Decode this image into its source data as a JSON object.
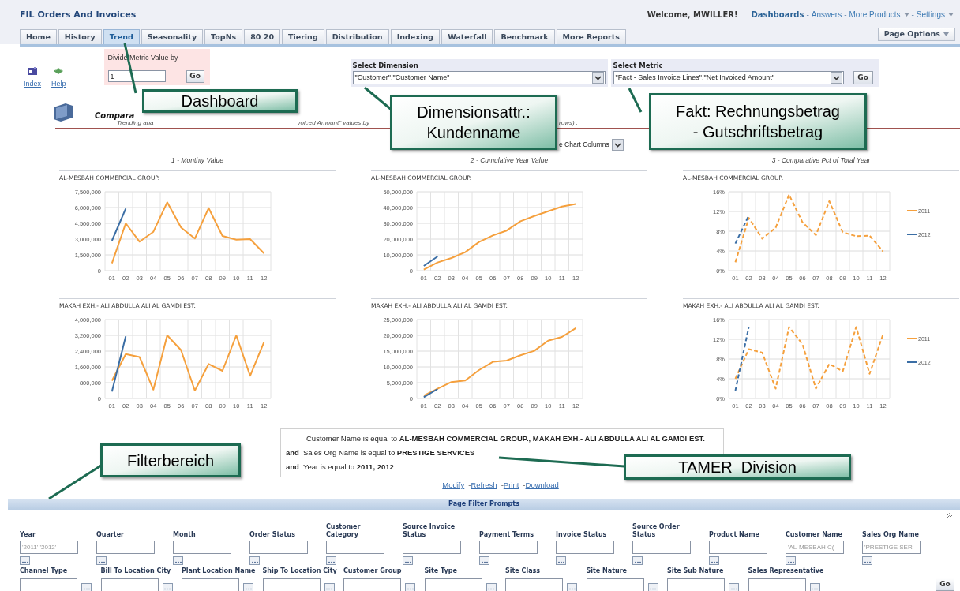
{
  "header": {
    "title": "FIL Orders And Invoices",
    "welcome": "Welcome, MWILLER!",
    "nav": [
      {
        "label": "Dashboards",
        "selected": true,
        "dropdown": false
      },
      {
        "prefix": "-",
        "label": "Answers",
        "selected": false,
        "dropdown": false
      },
      {
        "prefix": "-",
        "label": "More Products",
        "selected": false,
        "dropdown": true
      },
      {
        "prefix": "-",
        "label": "Settings",
        "selected": false,
        "dropdown": true
      }
    ]
  },
  "tabs": [
    {
      "label": "Home",
      "selected": false
    },
    {
      "label": "History",
      "selected": false
    },
    {
      "label": "Trend",
      "selected": true
    },
    {
      "label": "Seasonality",
      "selected": false
    },
    {
      "label": "TopNs",
      "selected": false
    },
    {
      "label": "80 20",
      "selected": false
    },
    {
      "label": "Tiering",
      "selected": false
    },
    {
      "label": "Distribution",
      "selected": false
    },
    {
      "label": "Indexing",
      "selected": false
    },
    {
      "label": "Waterfall",
      "selected": false
    },
    {
      "label": "Benchmark",
      "selected": false
    },
    {
      "label": "More Reports",
      "selected": false
    }
  ],
  "page_options": "Page Options",
  "toolbar": {
    "links": [
      {
        "kind": "index",
        "label": "Index"
      },
      {
        "kind": "help",
        "label": "Help"
      }
    ],
    "divide": {
      "label": "Divide Metric Value by",
      "value": "1",
      "button": "Go"
    },
    "dimension": {
      "label": "Select Dimension",
      "value": "\"Customer\".\"Customer Name\""
    },
    "metric": {
      "label": "Select Metric",
      "value": "\"Fact - Sales Invoice Lines\".\"Net Invoiced Amount\"",
      "button": "Go"
    }
  },
  "section": {
    "title": "Compara",
    "description": [
      "Trending ana",
      "voiced Amount\" values by",
      "rows) :"
    ],
    "column_chooser": "e Chart Columns"
  },
  "charts": {
    "column_titles": [
      "1 - Monthly Value",
      "2 - Cumulative Year Value",
      "3 - Comparative Pct of Total Year"
    ],
    "rows": [
      [
        {
          "chart_data": {
            "type": "line",
            "grid": true,
            "title": "AL-MESBAH COMMERCIAL GROUP.",
            "categories": [
              "01",
              "02",
              "03",
              "04",
              "05",
              "06",
              "07",
              "08",
              "09",
              "10",
              "11",
              "12"
            ],
            "ylim": [
              0,
              7500000
            ],
            "yticks": [
              {
                "value": 0,
                "label": "0"
              },
              {
                "value": 1500000,
                "label": "1,500,000"
              },
              {
                "value": 3000000,
                "label": "3,000,000"
              },
              {
                "value": 4500000,
                "label": "4,500,000"
              },
              {
                "value": 6000000,
                "label": "6,000,000"
              },
              {
                "value": 7500000,
                "label": "7,500,000"
              }
            ],
            "series": [
              {
                "color": "#f5a03d",
                "values": [
                  700000,
                  4500000,
                  2750000,
                  3700000,
                  6500000,
                  4100000,
                  3050000,
                  5950000,
                  3300000,
                  2950000,
                  3000000,
                  1650000
                ]
              },
              {
                "color": "#3b6ea5",
                "values": [
                  2850000,
                  5900000,
                  null,
                  null,
                  null,
                  null,
                  null,
                  null,
                  null,
                  null,
                  null,
                  null
                ]
              }
            ]
          }
        },
        {
          "chart_data": {
            "type": "line",
            "grid": true,
            "title": "AL-MESBAH COMMERCIAL GROUP.",
            "categories": [
              "01",
              "02",
              "03",
              "04",
              "05",
              "06",
              "07",
              "08",
              "09",
              "10",
              "11",
              "12"
            ],
            "ylim": [
              0,
              50000000
            ],
            "yticks": [
              {
                "value": 0,
                "label": "0"
              },
              {
                "value": 10000000,
                "label": "10,000,000"
              },
              {
                "value": 20000000,
                "label": "20,000,000"
              },
              {
                "value": 30000000,
                "label": "30,000,000"
              },
              {
                "value": 40000000,
                "label": "40,000,000"
              },
              {
                "value": 50000000,
                "label": "50,000,000"
              }
            ],
            "series": [
              {
                "color": "#f5a03d",
                "values": [
                  700000,
                  5200000,
                  8000000,
                  11700000,
                  18200000,
                  22300000,
                  25400000,
                  31300000,
                  34600000,
                  37600000,
                  40600000,
                  42200000
                ]
              },
              {
                "color": "#3b6ea5",
                "values": [
                  3000000,
                  9000000,
                  null,
                  null,
                  null,
                  null,
                  null,
                  null,
                  null,
                  null,
                  null,
                  null
                ]
              }
            ]
          }
        },
        {
          "chart_data": {
            "type": "line",
            "grid": true,
            "legend": true,
            "title": "AL-MESBAH COMMERCIAL GROUP.",
            "categories": [
              "01",
              "02",
              "03",
              "04",
              "05",
              "06",
              "07",
              "08",
              "09",
              "10",
              "11",
              "12"
            ],
            "ylim": [
              0,
              16
            ],
            "yticks": [
              {
                "value": 0,
                "label": "0%"
              },
              {
                "value": 4,
                "label": "4%"
              },
              {
                "value": 8,
                "label": "8%"
              },
              {
                "value": 12,
                "label": "12%"
              },
              {
                "value": 16,
                "label": "16%"
              }
            ],
            "series": [
              {
                "name": "2011",
                "color": "#f5a03d",
                "line_style": "dashed",
                "values": [
                  1.7,
                  10.7,
                  6.5,
                  8.7,
                  15.4,
                  9.8,
                  7.2,
                  14.1,
                  7.8,
                  7,
                  7.1,
                  3.9
                ]
              },
              {
                "name": "2012",
                "color": "#3b6ea5",
                "line_style": "dashed",
                "values": [
                  5.5,
                  11.2,
                  null,
                  null,
                  null,
                  null,
                  null,
                  null,
                  null,
                  null,
                  null,
                  null
                ]
              }
            ]
          }
        }
      ],
      [
        {
          "chart_data": {
            "type": "line",
            "grid": true,
            "title": "MAKAH EXH.- ALI ABDULLA ALI AL GAMDI EST.",
            "categories": [
              "01",
              "02",
              "03",
              "04",
              "05",
              "06",
              "07",
              "08",
              "09",
              "10",
              "11",
              "12"
            ],
            "ylim": [
              0,
              4000000
            ],
            "yticks": [
              {
                "value": 0,
                "label": "0"
              },
              {
                "value": 800000,
                "label": "800,000"
              },
              {
                "value": 1600000,
                "label": "1,600,000"
              },
              {
                "value": 2400000,
                "label": "2,400,000"
              },
              {
                "value": 3200000,
                "label": "3,200,000"
              },
              {
                "value": 4000000,
                "label": "4,000,000"
              }
            ],
            "series": [
              {
                "color": "#f5a03d",
                "values": [
                  900000,
                  2250000,
                  2100000,
                  450000,
                  3200000,
                  2450000,
                  400000,
                  1750000,
                  1400000,
                  3200000,
                  1150000,
                  2850000
                ]
              },
              {
                "color": "#3b6ea5",
                "values": [
                  350000,
                  3150000,
                  null,
                  null,
                  null,
                  null,
                  null,
                  null,
                  null,
                  null,
                  null,
                  null
                ]
              }
            ]
          }
        },
        {
          "chart_data": {
            "type": "line",
            "grid": true,
            "title": "MAKAH EXH.- ALI ABDULLA ALI AL GAMDI EST.",
            "categories": [
              "01",
              "02",
              "03",
              "04",
              "05",
              "06",
              "07",
              "08",
              "09",
              "10",
              "11",
              "12"
            ],
            "ylim": [
              0,
              25000000
            ],
            "yticks": [
              {
                "value": 0,
                "label": "0"
              },
              {
                "value": 5000000,
                "label": "5,000,000"
              },
              {
                "value": 10000000,
                "label": "10,000,000"
              },
              {
                "value": 15000000,
                "label": "15,000,000"
              },
              {
                "value": 20000000,
                "label": "20,000,000"
              },
              {
                "value": 25000000,
                "label": "25,000,000"
              }
            ],
            "series": [
              {
                "color": "#f5a03d",
                "values": [
                  900000,
                  3100000,
                  5200000,
                  5700000,
                  9000000,
                  11600000,
                  12000000,
                  13700000,
                  15100000,
                  18300000,
                  19500000,
                  22300000
                ]
              },
              {
                "color": "#3b6ea5",
                "values": [
                  400000,
                  3000000,
                  null,
                  null,
                  null,
                  null,
                  null,
                  null,
                  null,
                  null,
                  null,
                  null
                ]
              }
            ]
          }
        },
        {
          "chart_data": {
            "type": "line",
            "grid": true,
            "legend": true,
            "title": "MAKAH EXH.- ALI ABDULLA ALI AL GAMDI EST.",
            "categories": [
              "01",
              "02",
              "03",
              "04",
              "05",
              "06",
              "07",
              "08",
              "09",
              "10",
              "11",
              "12"
            ],
            "ylim": [
              0,
              16
            ],
            "yticks": [
              {
                "value": 0,
                "label": "0%"
              },
              {
                "value": 4,
                "label": "4%"
              },
              {
                "value": 8,
                "label": "8%"
              },
              {
                "value": 12,
                "label": "12%"
              },
              {
                "value": 16,
                "label": "16%"
              }
            ],
            "series": [
              {
                "name": "2011",
                "color": "#f5a03d",
                "line_style": "dashed",
                "values": [
                  4,
                  10,
                  9.3,
                  2,
                  14.5,
                  11,
                  2,
                  7,
                  5.5,
                  14.5,
                  5,
                  13
                ]
              },
              {
                "name": "2012",
                "color": "#3b6ea5",
                "line_style": "dashed",
                "values": [
                  1.6,
                  14.5,
                  null,
                  null,
                  null,
                  null,
                  null,
                  null,
                  null,
                  null,
                  null,
                  null
                ]
              }
            ]
          }
        }
      ]
    ]
  },
  "filter_summary": {
    "lines": [
      {
        "text": "Customer Name is equal to **AL-MESBAH COMMERCIAL GROUP., MAKAH EXH.- ALI ABDULLA ALI AL GAMDI EST.**"
      },
      {
        "conjunction": "and",
        "text": "Sales Org Name is equal to **PRESTIGE SERVICES**"
      },
      {
        "conjunction": "and",
        "text": "Year is equal to **2011, 2012**"
      }
    ],
    "links": [
      {
        "label": "Modify"
      },
      {
        "prefix": "-",
        "label": "Refresh"
      },
      {
        "prefix": "-",
        "label": "Print"
      },
      {
        "prefix": "-",
        "label": "Download"
      }
    ]
  },
  "page_filter_prompts": {
    "title": "Page Filter Prompts",
    "expanded": true,
    "go": "Go",
    "rows": [
      {
        "kind": "stacked",
        "items": [
          {
            "label": "Year",
            "value": "'2011','2012'"
          },
          {
            "label": "Quarter"
          },
          {
            "label": "Month"
          },
          {
            "label": "Order Status"
          },
          {
            "label": "Customer Category"
          },
          {
            "label": "Source Invoice Status"
          },
          {
            "label": "Payment Terms"
          },
          {
            "label": "Invoice Status"
          },
          {
            "label": "Source Order Status"
          },
          {
            "label": "Product Name"
          },
          {
            "label": "Customer Name",
            "value": "'AL-MESBAH C("
          },
          {
            "label": "Sales Org Name",
            "value": "'PRESTIGE SER'"
          }
        ]
      },
      {
        "kind": "inline",
        "items": [
          {
            "label": "Channel Type"
          },
          {
            "label": "Bill To Location City"
          },
          {
            "label": "Plant Location Name"
          },
          {
            "label": "Ship To Location City"
          },
          {
            "label": "Customer Group"
          },
          {
            "label": "Site Type"
          },
          {
            "label": "Site Class"
          },
          {
            "label": "Site Nature"
          },
          {
            "label": "Site Sub Nature"
          },
          {
            "label": "Sales Representative"
          }
        ]
      }
    ]
  },
  "callouts": [
    {
      "lines": [
        "Dashboard"
      ]
    },
    {
      "lines": [
        "Dimensionsattr.:",
        "Kundenname"
      ]
    },
    {
      "lines": [
        "Fakt: Rechnungsbetrag",
        "- Gutschriftsbetrag"
      ]
    },
    {
      "lines": [
        "Filterbereich"
      ]
    },
    {
      "lines": [
        "TAMER  Division"
      ]
    }
  ]
}
